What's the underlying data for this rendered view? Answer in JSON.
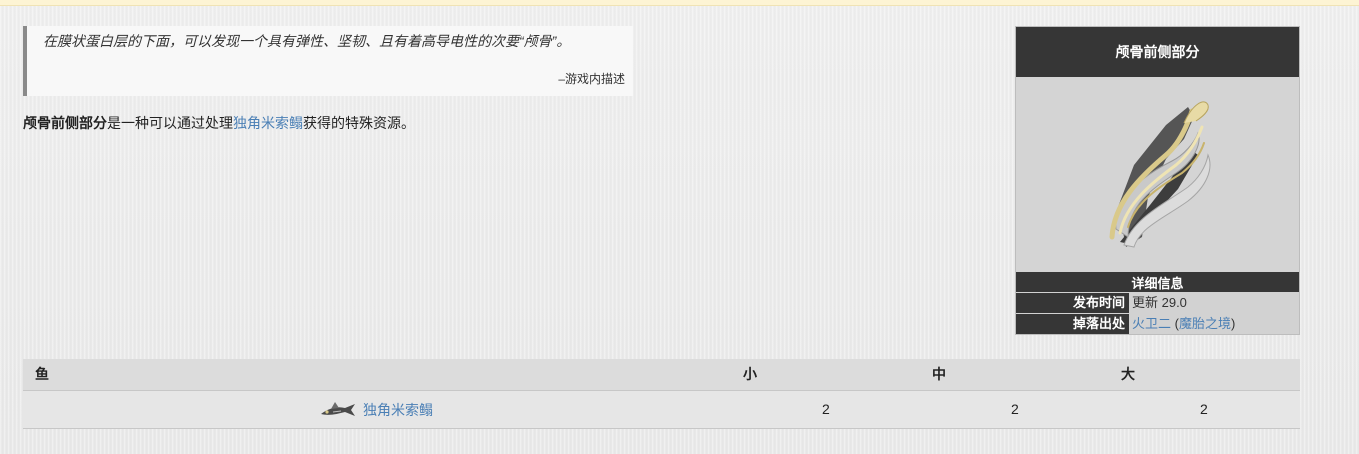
{
  "quote": {
    "text": "在膜状蛋白层的下面，可以发现一个具有弹性、坚韧、且有着高导电性的次要“颅骨”。",
    "source": "–游戏内描述"
  },
  "description": {
    "subject": "颅骨前侧部分",
    "text_before_link": "是一种可以通过处理",
    "link": "独角米索鳎",
    "text_after_link": "获得的特殊资源。"
  },
  "infobox": {
    "title": "颅骨前侧部分",
    "image_icon": "skull-fragment-icon",
    "section_title": "详细信息",
    "release_label": "发布时间",
    "release_value": "更新 29.0",
    "drop_label": "掉落出处",
    "drop_location": "火卫二",
    "drop_paren_open": " (",
    "drop_sub_location": "魔胎之境",
    "drop_paren_close": ")"
  },
  "table": {
    "headers": [
      "鱼",
      "小",
      "中",
      "大"
    ],
    "rows": [
      {
        "fish_icon": "fish-icon",
        "fish": "独角米索鳎",
        "small": "2",
        "medium": "2",
        "large": "2"
      }
    ]
  },
  "colors": {
    "link": "#4a7fb5",
    "infobox_dark": "#363636",
    "top_strip": "#fdf4d4"
  }
}
